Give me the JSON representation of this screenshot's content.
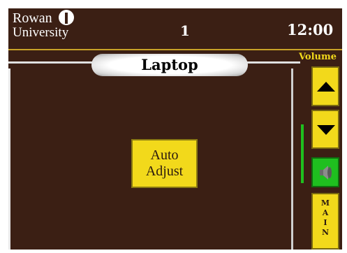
{
  "header": {
    "logo_line1": "Rowan",
    "logo_line2": "University",
    "room_number": "1",
    "clock": "12:00"
  },
  "page": {
    "title": "Laptop"
  },
  "controls": {
    "auto_adjust_line1": "Auto",
    "auto_adjust_line2": "Adjust"
  },
  "volume": {
    "label": "Volume",
    "level_fraction": 0.45
  },
  "main_button": {
    "letters": [
      "M",
      "A",
      "I",
      "N"
    ]
  },
  "colors": {
    "background": "#3b1f14",
    "button_yellow": "#f2d91b",
    "accent_gold": "#c9a227",
    "mute_green": "#1fbf1f",
    "text_white": "#ffffff"
  }
}
